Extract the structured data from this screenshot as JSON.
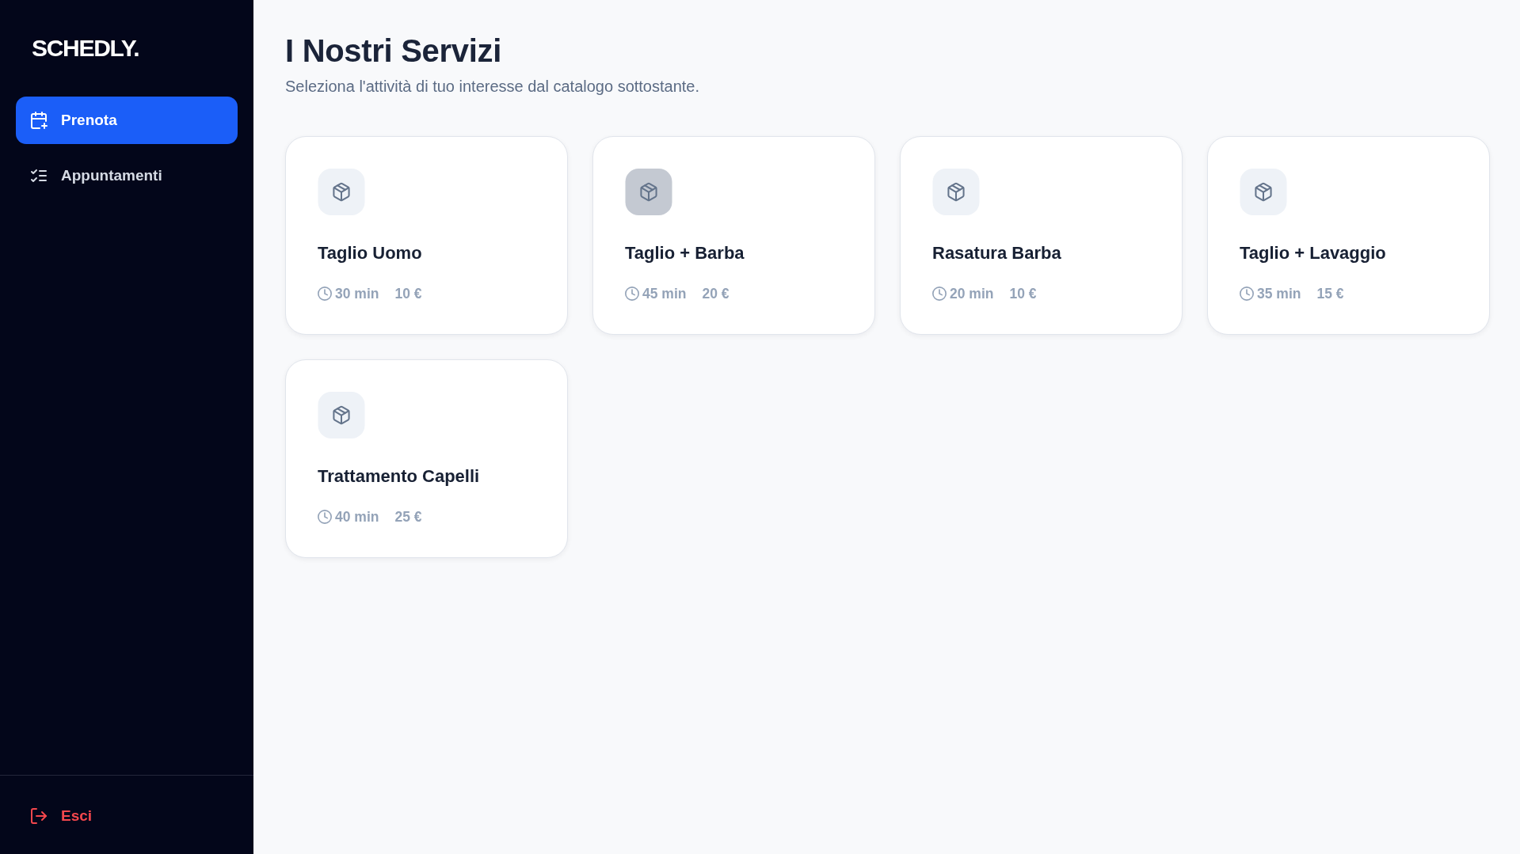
{
  "sidebar": {
    "logo": "SCHEDLY.",
    "nav_items": [
      {
        "label": "Prenota",
        "selected": true
      },
      {
        "label": "Appuntamenti",
        "selected": false
      }
    ],
    "logout": {
      "label": "Esci"
    }
  },
  "main": {
    "title": "I Nostri Servizi",
    "subtitle": "Seleziona l'attività di tuo interesse dal catalogo sottostante.",
    "services": [
      {
        "name": "Taglio Uomo",
        "duration": "30 min",
        "price": "10 €",
        "highlighted": false
      },
      {
        "name": "Taglio + Barba",
        "duration": "45 min",
        "price": "20 €",
        "highlighted": true
      },
      {
        "name": "Rasatura Barba",
        "duration": "20 min",
        "price": "10 €",
        "highlighted": false
      },
      {
        "name": "Taglio + Lavaggio",
        "duration": "35 min",
        "price": "15 €",
        "highlighted": false
      },
      {
        "name": "Trattamento Capelli",
        "duration": "40 min",
        "price": "25 €",
        "highlighted": false
      }
    ]
  }
}
